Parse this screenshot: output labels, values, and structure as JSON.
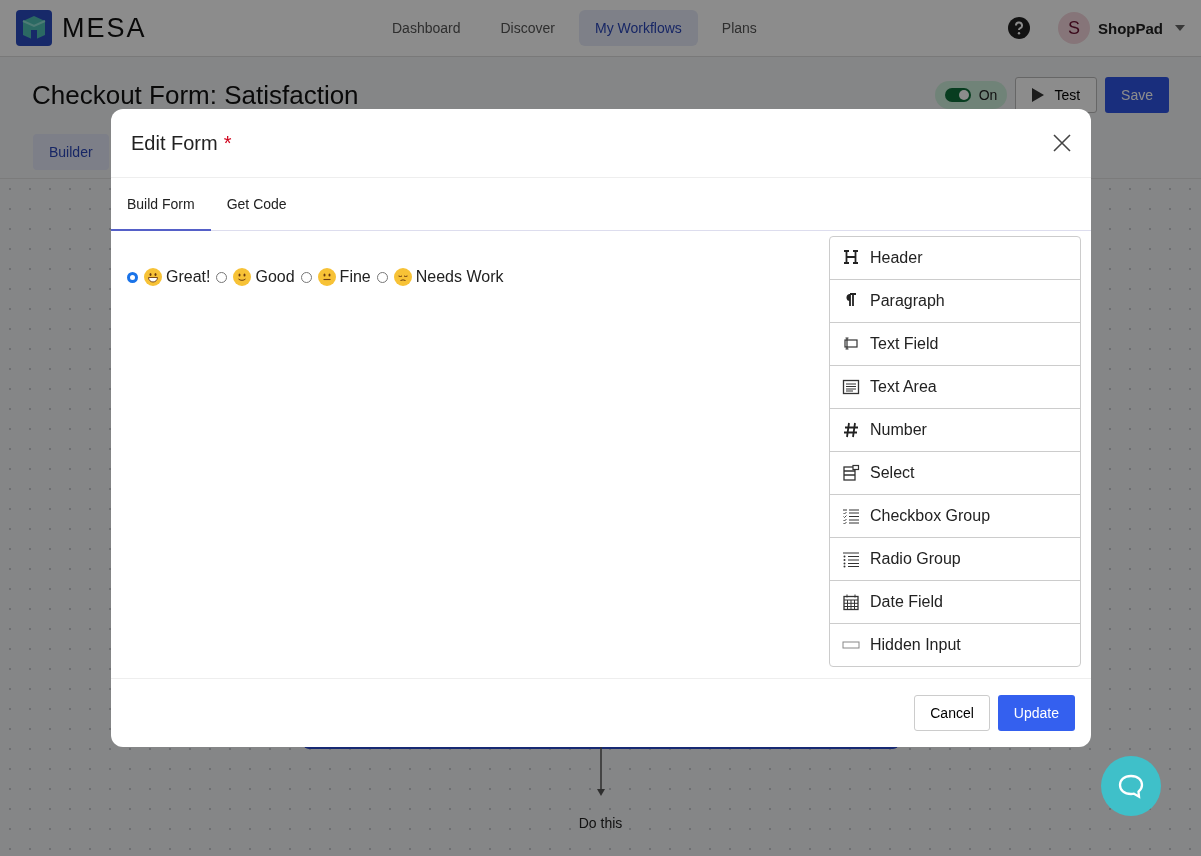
{
  "app": {
    "logo_text": "MESA"
  },
  "nav": [
    {
      "label": "Dashboard",
      "selected": false
    },
    {
      "label": "Discover",
      "selected": false
    },
    {
      "label": "My Workflows",
      "selected": true
    },
    {
      "label": "Plans",
      "selected": false
    }
  ],
  "account": {
    "avatar_letter": "S",
    "name": "ShopPad"
  },
  "page": {
    "title": "Checkout Form: Satisfaction",
    "toggle": {
      "on": true,
      "label": "On"
    },
    "test_button": "Test",
    "save_button": "Save",
    "tabs": [
      {
        "label": "Builder",
        "selected": true
      }
    ]
  },
  "canvas": {
    "step_label": "Do this"
  },
  "modal": {
    "title": "Edit Form",
    "required_mark": "*",
    "tabs": [
      {
        "label": "Build Form",
        "selected": true
      },
      {
        "label": "Get Code",
        "selected": false
      }
    ],
    "options": [
      {
        "kind": "grin",
        "label": "Great!",
        "selected": true
      },
      {
        "kind": "smile",
        "label": "Good",
        "selected": false
      },
      {
        "kind": "neutral",
        "label": "Fine",
        "selected": false
      },
      {
        "kind": "pensive",
        "label": "Needs Work",
        "selected": false
      }
    ],
    "fields": [
      {
        "kind": "header",
        "label": "Header"
      },
      {
        "kind": "paragraph",
        "label": "Paragraph"
      },
      {
        "kind": "text",
        "label": "Text Field"
      },
      {
        "kind": "textarea",
        "label": "Text Area"
      },
      {
        "kind": "number",
        "label": "Number"
      },
      {
        "kind": "select",
        "label": "Select"
      },
      {
        "kind": "checkbox",
        "label": "Checkbox Group"
      },
      {
        "kind": "radio",
        "label": "Radio Group"
      },
      {
        "kind": "date",
        "label": "Date Field"
      },
      {
        "kind": "hidden",
        "label": "Hidden Input"
      }
    ],
    "cancel_button": "Cancel",
    "update_button": "Update"
  }
}
